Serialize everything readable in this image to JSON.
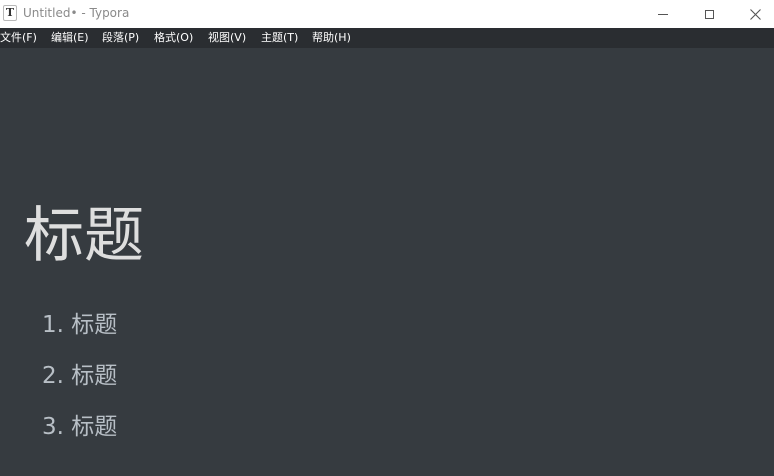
{
  "window": {
    "app_icon_glyph": "T",
    "title": "Untitled• - Typora"
  },
  "menu": [
    "文件(F)",
    "编辑(E)",
    "段落(P)",
    "格式(O)",
    "视图(V)",
    "主题(T)",
    "帮助(H)"
  ],
  "document": {
    "heading": "标题",
    "list": [
      {
        "number": "1.",
        "text": "标题"
      },
      {
        "number": "2.",
        "text": "标题"
      },
      {
        "number": "3.",
        "text": "标题"
      }
    ]
  },
  "colors": {
    "editor_background": "#363b40",
    "menubar_background": "#2a2d31",
    "heading_text": "#dedede",
    "body_text": "#b8bfc6"
  }
}
